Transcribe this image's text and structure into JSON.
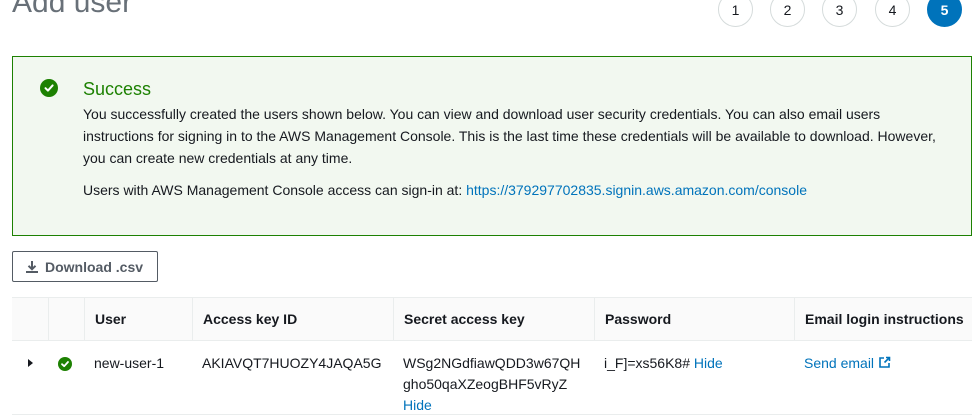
{
  "page": {
    "title": "Add user"
  },
  "steps": [
    "1",
    "2",
    "3",
    "4",
    "5"
  ],
  "alert": {
    "title": "Success",
    "body": "You successfully created the users shown below. You can view and download user security credentials. You can also email users instructions for signing in to the AWS Management Console. This is the last time these credentials will be available to download. However, you can create new credentials at any time.",
    "console_prefix": "Users with AWS Management Console access can sign-in at: ",
    "console_url": "https://379297702835.signin.aws.amazon.com/console"
  },
  "toolbar": {
    "download_label": "Download .csv"
  },
  "table": {
    "columns": [
      "User",
      "Access key ID",
      "Secret access key",
      "Password",
      "Email login instructions"
    ],
    "rows": [
      {
        "user": "new-user-1",
        "access_key_id": "AKIAVQT7HUOZY4JAQA5G",
        "secret_line1": "WSg2NGdfiawQDD3w67QH",
        "secret_line2": "gho50qaXZeogBHF5vRyZ",
        "secret_hide": "Hide",
        "password": "i_F]=xs56K8#",
        "password_hide": "Hide",
        "email_action": "Send email"
      }
    ]
  },
  "colors": {
    "accent": "#0073bb",
    "success": "#1d8102"
  }
}
